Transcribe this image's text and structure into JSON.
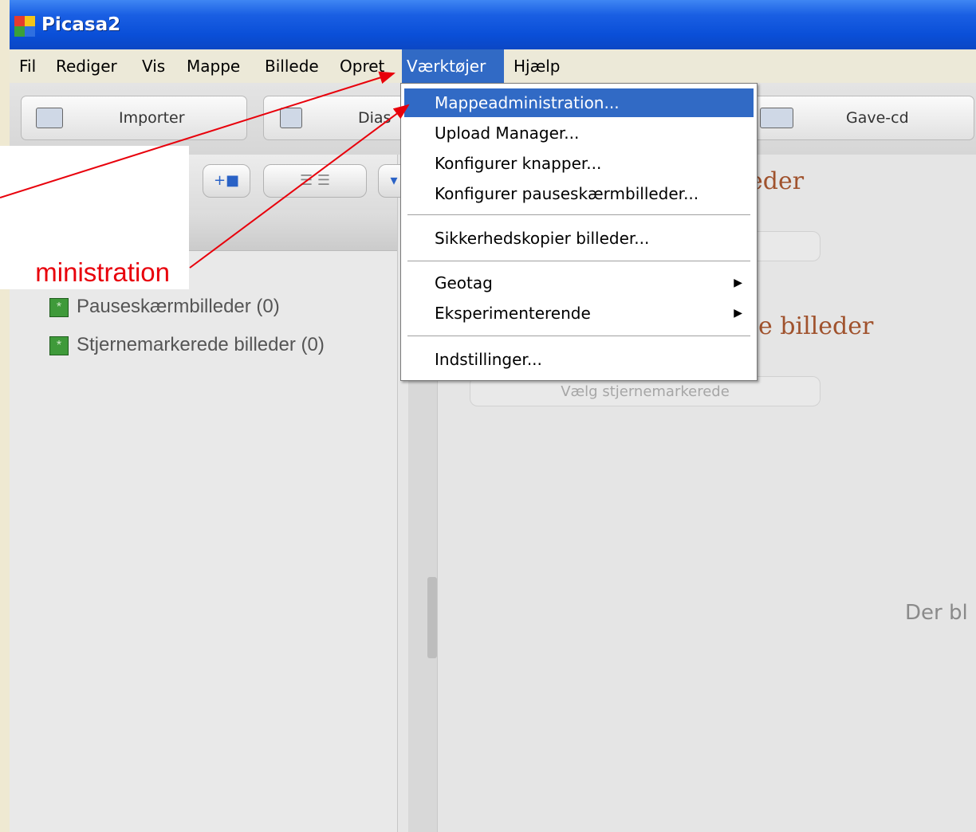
{
  "window": {
    "title": "Picasa2"
  },
  "menubar": {
    "items": [
      "Fil",
      "Rediger",
      "Vis",
      "Mappe",
      "Billede",
      "Opret",
      "Værktøjer",
      "Hjælp"
    ],
    "active": "Værktøjer"
  },
  "toolbar": {
    "import_label": "Importer",
    "slideshow_label": "Dias",
    "giftcd_label": "Gave-cd"
  },
  "dropdown": {
    "items": [
      "Mappeadministration...",
      "Upload Manager...",
      "Konfigurer knapper...",
      "Konfigurer pauseskærmbilleder...",
      "Sikkerhedskopier billeder...",
      "Geotag",
      "Eksperimenterende",
      "Indstillinger..."
    ],
    "highlighted": "Mappeadministration..."
  },
  "folders": [
    {
      "label": "Pauseskærmbilleder (0)"
    },
    {
      "label": "Stjernemarkerede billeder (0)"
    }
  ],
  "main": {
    "heading1_visible": "eder",
    "heading2_visible": "e billeder",
    "select_starred_label": "Vælg stjernemarkerede",
    "empty_message_visible": "Der bl"
  },
  "annotation": {
    "text_visible": "ministration"
  },
  "colors": {
    "accent": "#316ac5",
    "titlebar": "#0a4fd8",
    "annotation": "#e8000b",
    "heading": "#a0522d"
  }
}
